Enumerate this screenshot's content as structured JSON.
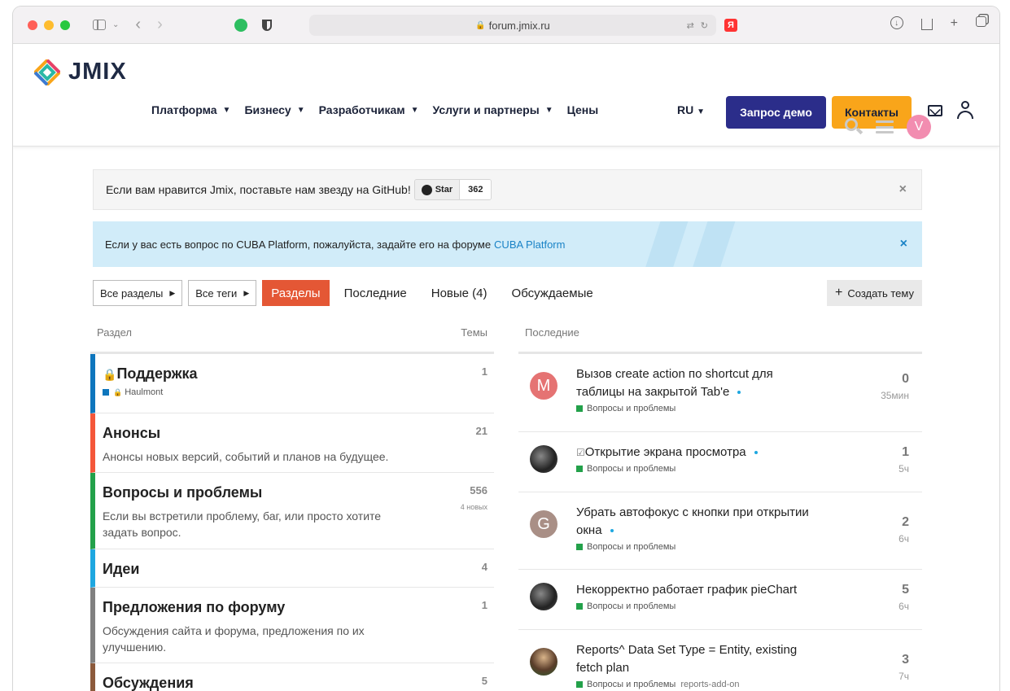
{
  "browser": {
    "url": "forum.jmix.ru",
    "yandex_badge": "Я"
  },
  "header": {
    "logo_text": "JMIX",
    "nav": [
      {
        "label": "Платформа",
        "dropdown": true
      },
      {
        "label": "Бизнесу",
        "dropdown": true
      },
      {
        "label": "Разработчикам",
        "dropdown": true
      },
      {
        "label": "Услуги и партнеры",
        "dropdown": true
      },
      {
        "label": "Цены",
        "dropdown": false
      }
    ],
    "lang": "RU",
    "demo_button": "Запрос демо",
    "contacts_button": "Контакты",
    "user_avatar_letter": "V",
    "colors": {
      "demo": "#2b2d8a",
      "contacts": "#f9a51a",
      "avatar": "#f28db0"
    }
  },
  "banners": {
    "star_text": "Если вам нравится Jmix, поставьте нам звезду на GitHub!",
    "star_button": "Star",
    "star_count": "362",
    "cuba_text": "Если у вас есть вопрос по CUBA Platform, пожалуйста, задайте его на форуме",
    "cuba_link": "CUBA Platform",
    "close": "×"
  },
  "toolbar": {
    "all_categories": "Все разделы",
    "all_tags": "Все теги",
    "tabs": [
      "Разделы",
      "Последние",
      "Новые (4)",
      "Обсуждаемые"
    ],
    "create_topic": "Создать тему",
    "active_color": "#e45735"
  },
  "categories": {
    "head_label": "Раздел",
    "head_count": "Темы",
    "items": [
      {
        "title": "Поддержка",
        "locked": true,
        "sub": "Haulmont",
        "count": "1",
        "new": "",
        "desc": "",
        "color": "#0e76bd"
      },
      {
        "title": "Анонсы",
        "locked": false,
        "sub": "",
        "count": "21",
        "new": "",
        "desc": "Анонсы новых версий, событий и планов на будущее.",
        "color": "#f4573a"
      },
      {
        "title": "Вопросы и проблемы",
        "locked": false,
        "sub": "",
        "count": "556",
        "new": "4 новых",
        "desc": "Если вы встретили проблему, баг, или просто хотите задать вопрос.",
        "color": "#23a14a"
      },
      {
        "title": "Идеи",
        "locked": false,
        "sub": "",
        "count": "4",
        "new": "",
        "desc": "",
        "color": "#1ea7e0"
      },
      {
        "title": "Предложения по форуму",
        "locked": false,
        "sub": "",
        "count": "1",
        "new": "",
        "desc": "Обсуждения сайта и форума, предложения по их улучшению.",
        "color": "#808080"
      },
      {
        "title": "Обсуждения",
        "locked": false,
        "sub": "",
        "count": "5",
        "new": "",
        "desc": "",
        "color": "#8c5a3c"
      }
    ]
  },
  "latest": {
    "head_label": "Последние",
    "items": [
      {
        "avatar": "M",
        "avatar_color": "#e57373",
        "title": "Вызов create action по shortcut для таблицы на закрытой Tab'e",
        "prefix": "",
        "category": "Вопросы и проблемы",
        "tags": "",
        "replies": "0",
        "time": "35мин"
      },
      {
        "avatar": "",
        "avatar_color": "",
        "title": "Открытие экрана просмотра",
        "prefix": "☑",
        "category": "Вопросы и проблемы",
        "tags": "",
        "replies": "1",
        "time": "5ч"
      },
      {
        "avatar": "G",
        "avatar_color": "#a98f86",
        "title": "Убрать автофокус с кнопки при открытии окна",
        "prefix": "",
        "category": "Вопросы и проблемы",
        "tags": "",
        "replies": "2",
        "time": "6ч"
      },
      {
        "avatar": "",
        "avatar_color": "",
        "title": "Некорректно работает график pieChart",
        "prefix": "",
        "category": "Вопросы и проблемы",
        "tags": "",
        "replies": "5",
        "time": "6ч"
      },
      {
        "avatar": "",
        "avatar_color": "",
        "title": "Reports^ Data Set Type = Entity, existing fetch plan",
        "prefix": "",
        "category": "Вопросы и проблемы",
        "tags": "reports-add-on",
        "replies": "3",
        "time": "7ч"
      }
    ]
  }
}
